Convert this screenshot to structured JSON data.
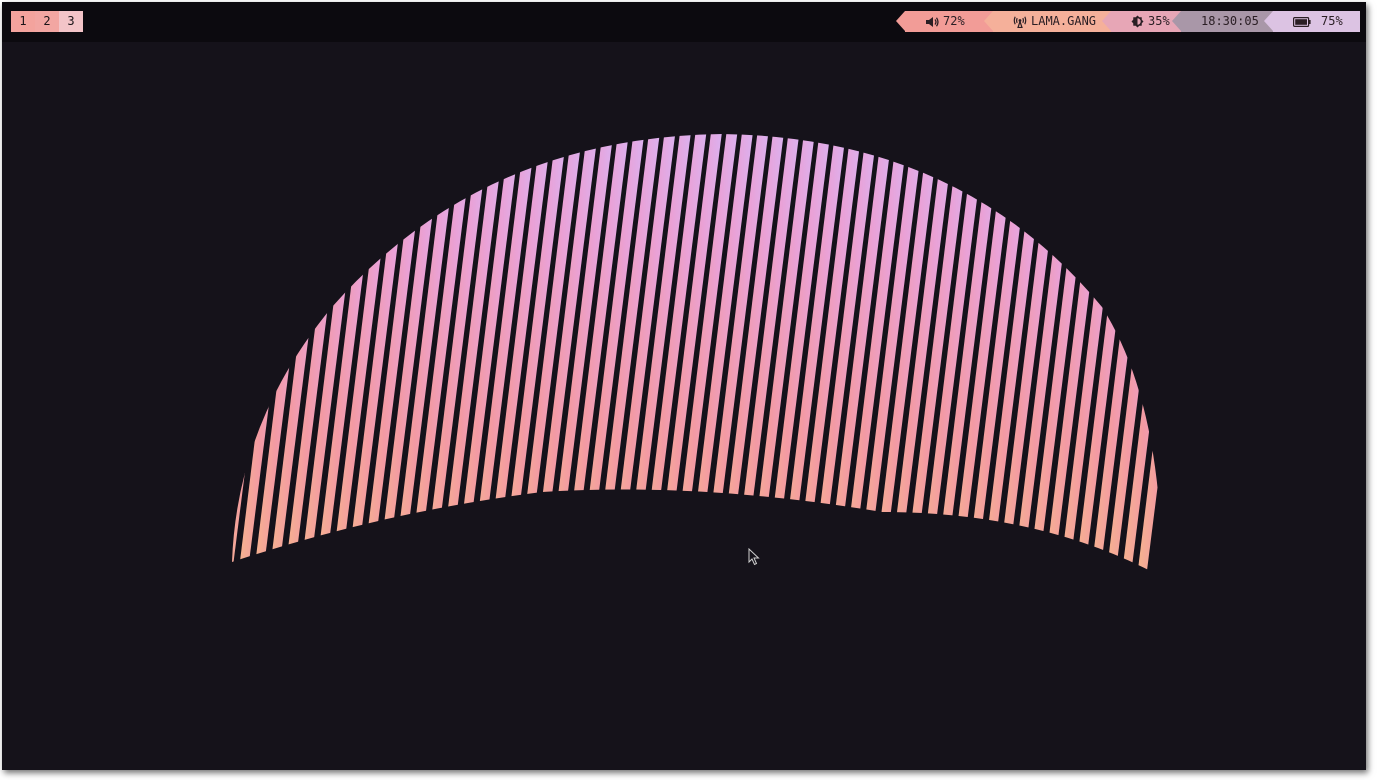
{
  "workspaces": [
    "1",
    "2",
    "3"
  ],
  "status": {
    "volume": {
      "icon": "speaker-icon",
      "value": "72%"
    },
    "network": {
      "icon": "wifi-antenna-icon",
      "value": "LAMA.GANG"
    },
    "brightness": {
      "icon": "brightness-icon",
      "value": "35%"
    },
    "clock": {
      "value": "18:30:05"
    },
    "battery": {
      "icon": "battery-icon",
      "value": "75%"
    }
  },
  "wallpaper": {
    "description_colors": [
      "#f6b58a",
      "#f29aa4",
      "#e9a1d8",
      "#d7b1f2"
    ]
  },
  "colors": {
    "desktop_bg": "#15121a",
    "bar_bg": "#0c0a0f"
  }
}
